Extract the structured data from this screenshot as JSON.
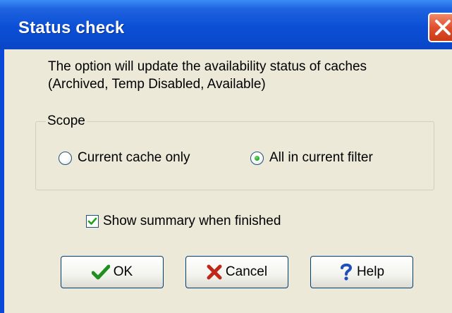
{
  "window": {
    "title": "Status check",
    "close_icon": "close-icon"
  },
  "description": {
    "line1": "The option will update the availability status of caches",
    "line2": "(Archived, Temp Disabled, Available)"
  },
  "scope": {
    "label": "Scope",
    "options": [
      {
        "label": "Current cache only",
        "selected": false
      },
      {
        "label": "All in current filter",
        "selected": true
      }
    ]
  },
  "summary": {
    "label": "Show summary when finished",
    "checked": true
  },
  "buttons": {
    "ok": {
      "label": "OK",
      "icon": "checkmark-icon"
    },
    "cancel": {
      "label": "Cancel",
      "icon": "x-icon"
    },
    "help": {
      "label": "Help",
      "icon": "question-icon"
    }
  },
  "colors": {
    "titlebar": "#0a49d8",
    "dialog_bg": "#ece9d8",
    "close_button": "#e0502c"
  }
}
